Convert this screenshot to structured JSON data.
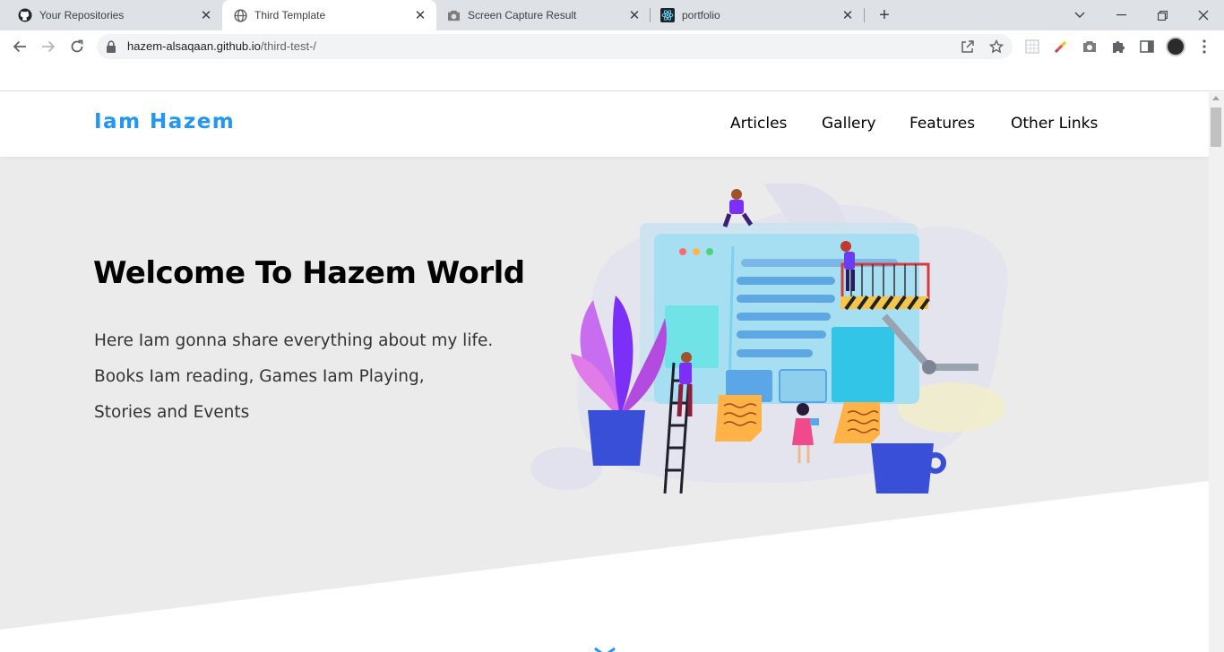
{
  "browser": {
    "tabs": [
      {
        "title": "Your Repositories",
        "icon": "github-icon",
        "active": false
      },
      {
        "title": "Third Template",
        "icon": "globe-icon",
        "active": true
      },
      {
        "title": "Screen Capture Result",
        "icon": "camera-icon",
        "active": false
      },
      {
        "title": "portfolio",
        "icon": "react-icon",
        "active": false
      }
    ],
    "url_host": "hazem-alsaqaan.github.io",
    "url_path": "/third-test-/"
  },
  "site": {
    "logo": "Iam Hazem",
    "nav": [
      "Articles",
      "Gallery",
      "Features",
      "Other Links"
    ],
    "hero_title": "Welcome To Hazem World",
    "hero_lines": [
      "Here Iam gonna share everything about my life.",
      "Books Iam reading, Games Iam Playing,",
      "Stories and Events"
    ]
  },
  "colors": {
    "accent": "#2196f3",
    "hero_bg": "#ebebeb"
  }
}
